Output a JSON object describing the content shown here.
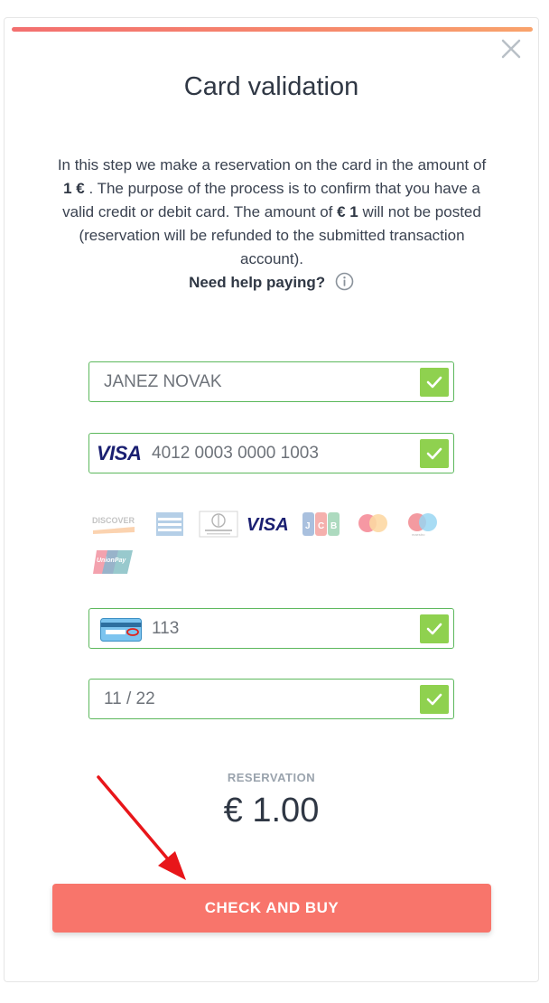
{
  "modal": {
    "title": "Card validation",
    "close_icon": "close-icon"
  },
  "description": {
    "part1": "In this step we make a reservation on the card in the amount of ",
    "amount1": "1 €",
    "part2": " . The purpose of the process is to confirm that you have a valid credit or debit card. The amount of ",
    "amount2": "€ 1",
    "part3": " will not be posted (reservation will be refunded to the submitted transaction account).",
    "help": "Need help paying?",
    "help_icon": "info-icon"
  },
  "form": {
    "name": {
      "value": "JANEZ NOVAK",
      "icon": "check-icon"
    },
    "card_number": {
      "brand": "VISA",
      "value": "4012 0003 0000 1003",
      "icon": "check-icon"
    },
    "cvc": {
      "value": "113",
      "card_icon": "cvc-card-icon",
      "icon": "check-icon"
    },
    "expiry": {
      "value": "11 / 22",
      "icon": "check-icon"
    },
    "accent_color": "#5cb85c",
    "check_color": "#8fd14f"
  },
  "brands": [
    "DISCOVER",
    "AMERICAN EXPRESS",
    "Diners Club",
    "VISA",
    "JCB",
    "mastercard",
    "maestro",
    "UnionPay"
  ],
  "reservation": {
    "label": "RESERVATION",
    "amount": "€ 1.00"
  },
  "buy_button": {
    "label": "CHECK AND BUY",
    "color": "#f8756b"
  },
  "annotation": {
    "arrow_color": "#e8161a"
  }
}
